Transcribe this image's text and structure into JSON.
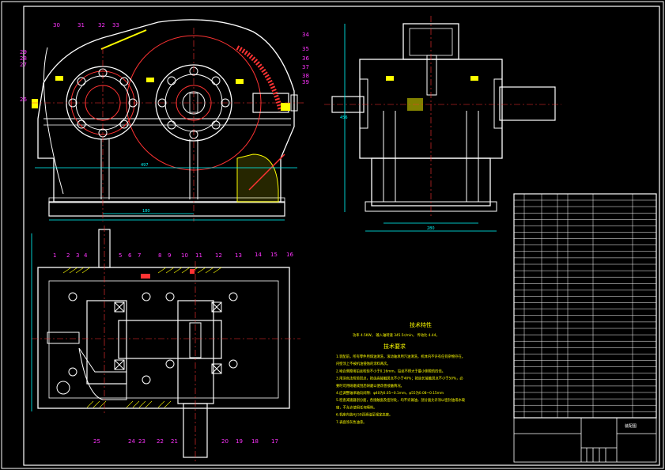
{
  "drawing": {
    "elevation_labels": [
      "30",
      "31",
      "32",
      "33",
      "34",
      "35",
      "36",
      "37",
      "38",
      "39",
      "29",
      "28",
      "27",
      "26",
      "14",
      "15",
      "16"
    ],
    "plan_labels": [
      "1",
      "2",
      "3",
      "4",
      "5",
      "6",
      "7",
      "8",
      "9",
      "10",
      "11",
      "12",
      "13",
      "25",
      "24",
      "23",
      "22",
      "21",
      "20",
      "19",
      "18",
      "17"
    ],
    "dimensions": {
      "overall_length": "497",
      "base_spacing": "180",
      "side_height": "456",
      "side_width": "280"
    },
    "notes": {
      "tech_title": "技术特性",
      "tech_line": "功率 4.5KW，  输入轴转速 345.5r/min，  传动比 4.44，",
      "req_title": "技术要求",
      "req_lines": [
        "1.装配前，所有零件用煤油清洗，滚动轴承用汽油清洗，机体内不许有任何杂物存在。",
        "  内壁涂上不被机油侵蚀的涂料两次。",
        "2.啮合侧隙用铅丝检验不小于0.16mm，铅丝不得大于最小侧隙的四倍。",
        "3.用涂色法检验斑点，按齿高接触斑点不小于40%；按齿长接触斑点不小于50%，必",
        "  要时可用研磨或刮后研磨以便改善接触情况。",
        "4.应调整轴承轴向间隙：φ40为0.05~0.1mm，φ55为0.08~0.15mm",
        "5.检查减速器剖分面，各接触面及密封处，均不许漏油，剖分面允许涂以密封油或水玻",
        "  璃，不允许使用任何填料。",
        "6.机座内装HJ-50润滑油至规定高度。",
        "7.表面涂灰色油漆。"
      ]
    }
  },
  "title_block": {
    "title": "装配图"
  }
}
